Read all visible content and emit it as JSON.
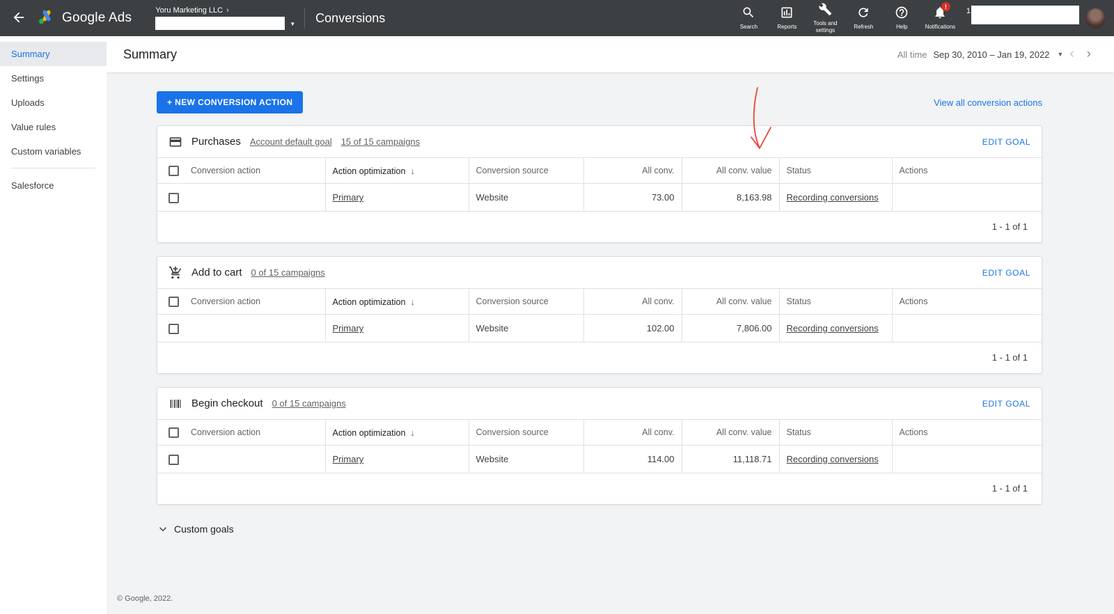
{
  "topbar": {
    "brand": "Google Ads",
    "account": {
      "name": "Yoru Marketing LLC",
      "id_prefix": "1"
    },
    "page_title": "Conversions",
    "icons": {
      "search": "Search",
      "reports": "Reports",
      "tools": "Tools and settings",
      "refresh": "Refresh",
      "help": "Help",
      "notifications": "Notifications",
      "notification_badge": "!"
    }
  },
  "sidebar": {
    "items": [
      {
        "label": "Summary",
        "selected": true
      },
      {
        "label": "Settings",
        "selected": false
      },
      {
        "label": "Uploads",
        "selected": false
      },
      {
        "label": "Value rules",
        "selected": false
      },
      {
        "label": "Custom variables",
        "selected": false
      },
      {
        "label": "Salesforce",
        "selected": false
      }
    ]
  },
  "header": {
    "title": "Summary",
    "date_preset": "All time",
    "date_range": "Sep 30, 2010 – Jan 19, 2022"
  },
  "actions": {
    "new_conversion": "+ NEW CONVERSION ACTION",
    "view_all": "View all conversion actions",
    "edit_goal": "EDIT GOAL"
  },
  "columns": {
    "action": "Conversion action",
    "optimization": "Action optimization",
    "source": "Conversion source",
    "all_conv": "All conv.",
    "all_conv_value": "All conv. value",
    "status": "Status",
    "actions": "Actions"
  },
  "goals": [
    {
      "icon": "credit-card-icon",
      "title": "Purchases",
      "badge": "Account default goal",
      "campaigns": "15 of 15 campaigns",
      "row": {
        "action": "",
        "optimization": "Primary",
        "source": "Website",
        "all_conv": "73.00",
        "all_conv_value": "8,163.98",
        "status": "Recording conversions"
      },
      "pagination": "1 - 1 of 1"
    },
    {
      "icon": "add-to-cart-icon",
      "title": "Add to cart",
      "campaigns": "0 of 15 campaigns",
      "row": {
        "action": "",
        "optimization": "Primary",
        "source": "Website",
        "all_conv": "102.00",
        "all_conv_value": "7,806.00",
        "status": "Recording conversions"
      },
      "pagination": "1 - 1 of 1"
    },
    {
      "icon": "barcode-icon",
      "title": "Begin checkout",
      "campaigns": "0 of 15 campaigns",
      "row": {
        "action": "",
        "optimization": "Primary",
        "source": "Website",
        "all_conv": "114.00",
        "all_conv_value": "11,118.71",
        "status": "Recording conversions"
      },
      "pagination": "1 - 1 of 1"
    }
  ],
  "custom_goals_label": "Custom goals",
  "footer": "© Google, 2022.",
  "colors": {
    "accent_blue": "#1a73e8",
    "topbar_bg": "#3c4043",
    "annotation_red": "#ea4335",
    "brand_yellow": "#fbbc04",
    "brand_blue": "#4285f4",
    "brand_green": "#34a853",
    "badge_red": "#d93025"
  }
}
